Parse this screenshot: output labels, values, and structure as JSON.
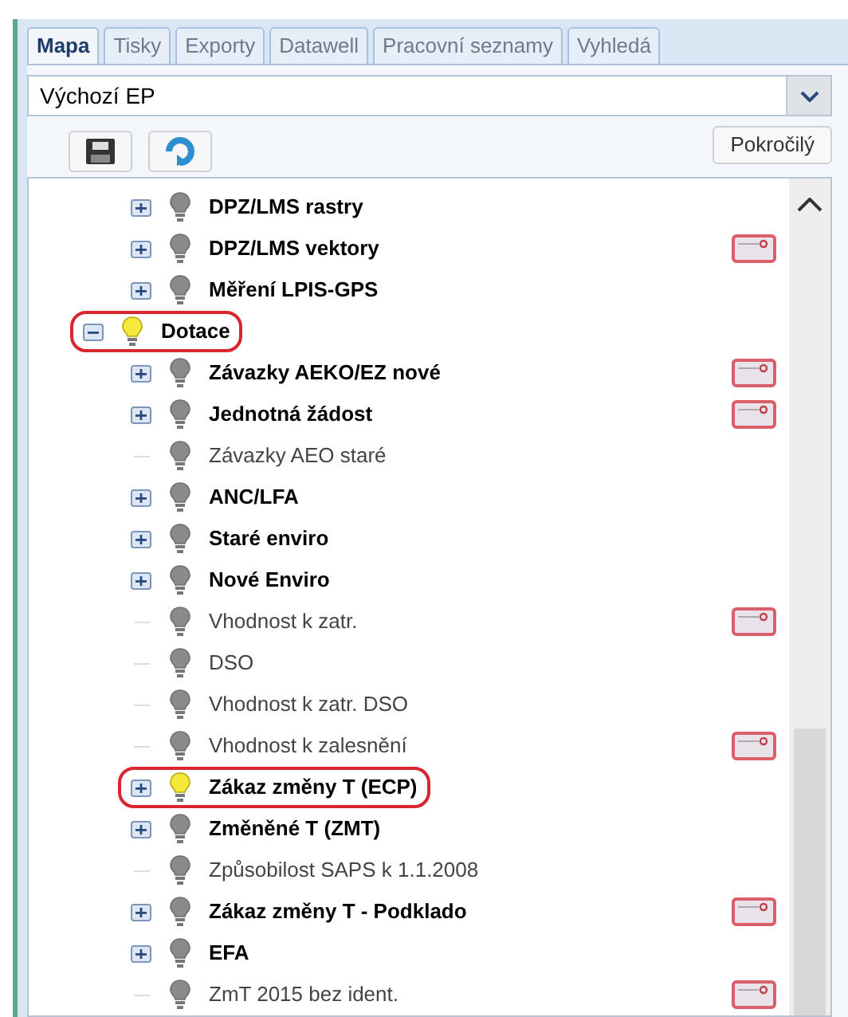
{
  "tabs": [
    {
      "label": "Mapa",
      "selected": true
    },
    {
      "label": "Tisky",
      "selected": false
    },
    {
      "label": "Exporty",
      "selected": false
    },
    {
      "label": "Datawell",
      "selected": false
    },
    {
      "label": "Pracovní seznamy",
      "selected": false
    },
    {
      "label": "Vyhledá",
      "selected": false
    }
  ],
  "profile_select": {
    "value": "Výchozí EP"
  },
  "toolbar": {
    "advanced_button": "Pokročilý"
  },
  "tree": {
    "continued_rows": [
      {
        "label": "DPZ/LMS rastry",
        "kind": "group",
        "expanded": false,
        "visible": false
      },
      {
        "label": "DPZ/LMS vektory",
        "kind": "group",
        "expanded": false,
        "visible": false,
        "legend": true
      },
      {
        "label": "Měření LPIS-GPS",
        "kind": "group",
        "expanded": false,
        "visible": false
      }
    ],
    "items": [
      {
        "label": "Dotace",
        "kind": "group",
        "expanded": true,
        "visible": true,
        "circled": true,
        "children": [
          {
            "label": "Závazky AEKO/EZ nové",
            "kind": "group",
            "expanded": false,
            "visible": false,
            "legend": true
          },
          {
            "label": "Jednotná žádost",
            "kind": "group",
            "expanded": false,
            "visible": false,
            "legend": true
          },
          {
            "label": "Závazky AEO staré",
            "kind": "layer",
            "visible": false
          },
          {
            "label": "ANC/LFA",
            "kind": "group",
            "expanded": false,
            "visible": false
          },
          {
            "label": "Staré enviro",
            "kind": "group",
            "expanded": false,
            "visible": false
          },
          {
            "label": "Nové Enviro",
            "kind": "group",
            "expanded": false,
            "visible": false
          },
          {
            "label": "Vhodnost k zatr.",
            "kind": "layer",
            "visible": false,
            "legend": true
          },
          {
            "label": "DSO",
            "kind": "layer",
            "visible": false
          },
          {
            "label": "Vhodnost k zatr. DSO",
            "kind": "layer",
            "visible": false
          },
          {
            "label": "Vhodnost k zalesnění",
            "kind": "layer",
            "visible": false,
            "legend": true
          },
          {
            "label": "Zákaz změny T (ECP)",
            "kind": "group",
            "expanded": false,
            "visible": true,
            "circled": true
          },
          {
            "label": "Změněné T (ZMT)",
            "kind": "group",
            "expanded": false,
            "visible": false
          },
          {
            "label": "Způsobilost SAPS k 1.1.2008",
            "kind": "layer",
            "visible": false
          },
          {
            "label": "Zákaz změny T - Podklado",
            "kind": "group",
            "expanded": false,
            "visible": false,
            "legend": true
          },
          {
            "label": "EFA",
            "kind": "group",
            "expanded": false,
            "visible": false
          },
          {
            "label": "ZmT 2015 bez ident.",
            "kind": "layer",
            "visible": false,
            "legend": true
          }
        ]
      }
    ]
  }
}
